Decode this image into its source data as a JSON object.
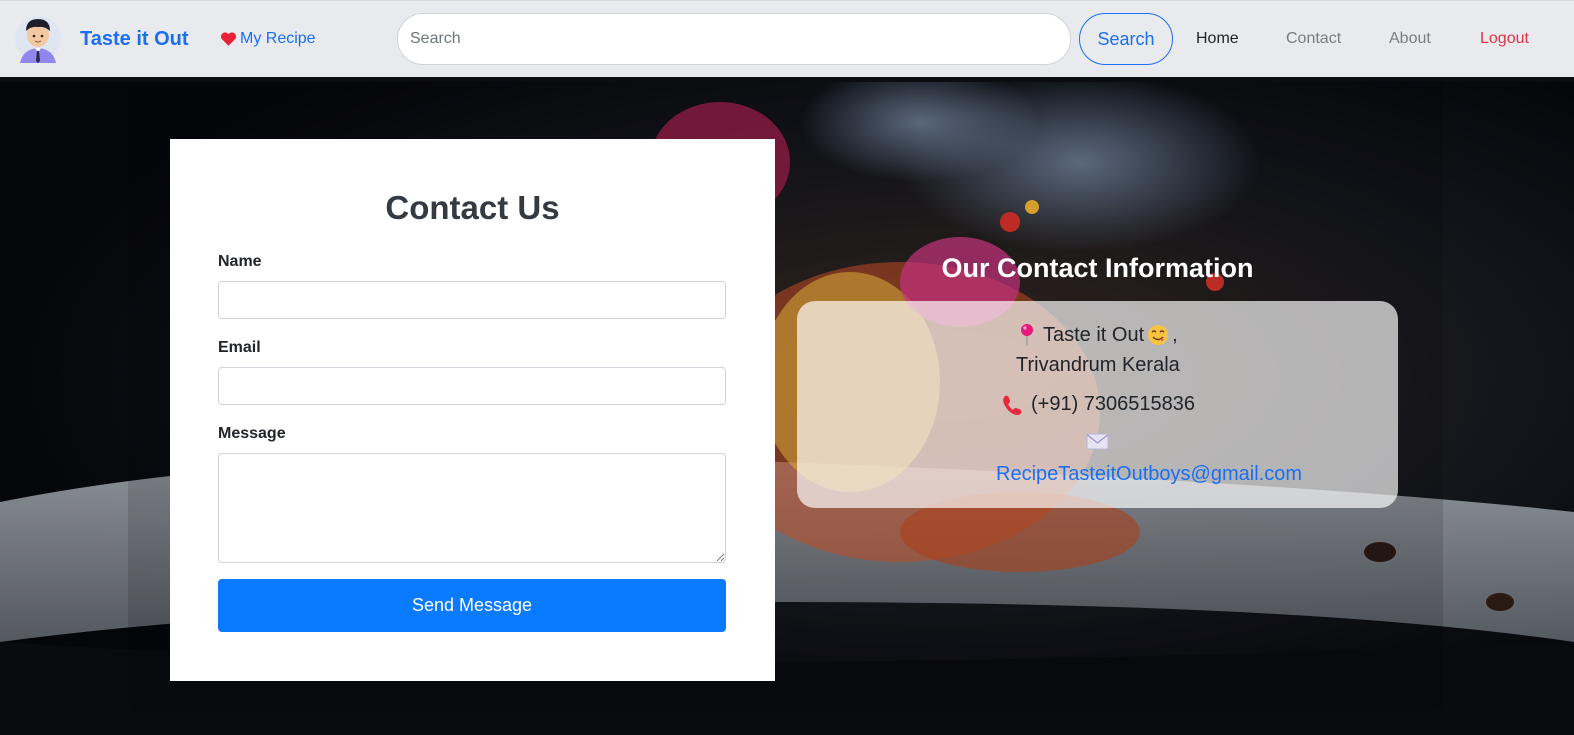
{
  "nav": {
    "brand": "Taste it Out",
    "my_recipe": "My Recipe",
    "search_placeholder": "Search",
    "search_button": "Search",
    "links": [
      "Home",
      "Contact",
      "About",
      "Logout"
    ]
  },
  "contact_form": {
    "title": "Contact Us",
    "name_label": "Name",
    "email_label": "Email",
    "message_label": "Message",
    "submit_label": "Send Message"
  },
  "contact_info": {
    "title": "Our Contact Information",
    "business_name": "Taste it Out",
    "business_suffix": ",",
    "location": "Trivandrum Kerala",
    "phone": "(+91) 7306515836",
    "email": "RecipeTasteitOutboys@gmail.com"
  },
  "colors": {
    "brand": "#1a6ff2",
    "logout": "#dc3545",
    "submit": "#0a7bff"
  },
  "icons": [
    "avatar",
    "heart-icon",
    "pin-icon",
    "smile-emoji-icon",
    "phone-icon",
    "envelope-icon"
  ]
}
